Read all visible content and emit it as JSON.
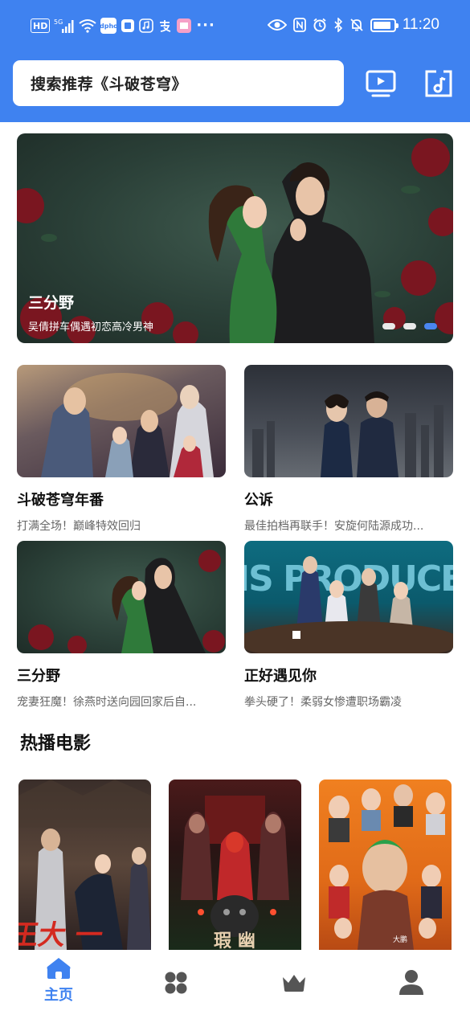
{
  "status_bar": {
    "left_badges": [
      "HD",
      "5G"
    ],
    "app_icon_text": "dpho",
    "time": "11:20",
    "battery_level": 0.9
  },
  "search": {
    "text": "搜索推荐《斗破苍穹》"
  },
  "header_icons": [
    "tv-icon",
    "music-note-icon"
  ],
  "banner": {
    "title": "三分野",
    "subtitle": "吴倩拼车偶遇初恋高冷男神",
    "page_count": 3,
    "active_page": 3
  },
  "cards": [
    {
      "title": "斗破苍穹年番",
      "desc": "打满全场！巅峰特效回归"
    },
    {
      "title": "公诉",
      "desc": "最佳拍档再联手！安旋何陆源成功..."
    },
    {
      "title": "三分野",
      "desc": "宠妻狂魔！徐燕时送向园回家后自..."
    },
    {
      "title": "正好遇见你",
      "desc": "拳头硬了！柔弱女惨遭职场霸凌"
    }
  ],
  "card_overlay_text": {
    "producer": "HIS PRODUCER"
  },
  "section": {
    "hot_movies": "热播电影"
  },
  "posters": [
    {
      "name": "poster-1"
    },
    {
      "name": "poster-2"
    },
    {
      "name": "poster-3",
      "overlay": "大鹏"
    }
  ],
  "bottom_nav": {
    "items": [
      {
        "label": "主页",
        "icon": "home-icon",
        "active": true
      },
      {
        "label": "",
        "icon": "categories-icon",
        "active": false
      },
      {
        "label": "",
        "icon": "crown-icon",
        "active": false
      },
      {
        "label": "",
        "icon": "user-icon",
        "active": false
      }
    ]
  },
  "colors": {
    "accent": "#3f82f0",
    "inactive": "#555555"
  }
}
